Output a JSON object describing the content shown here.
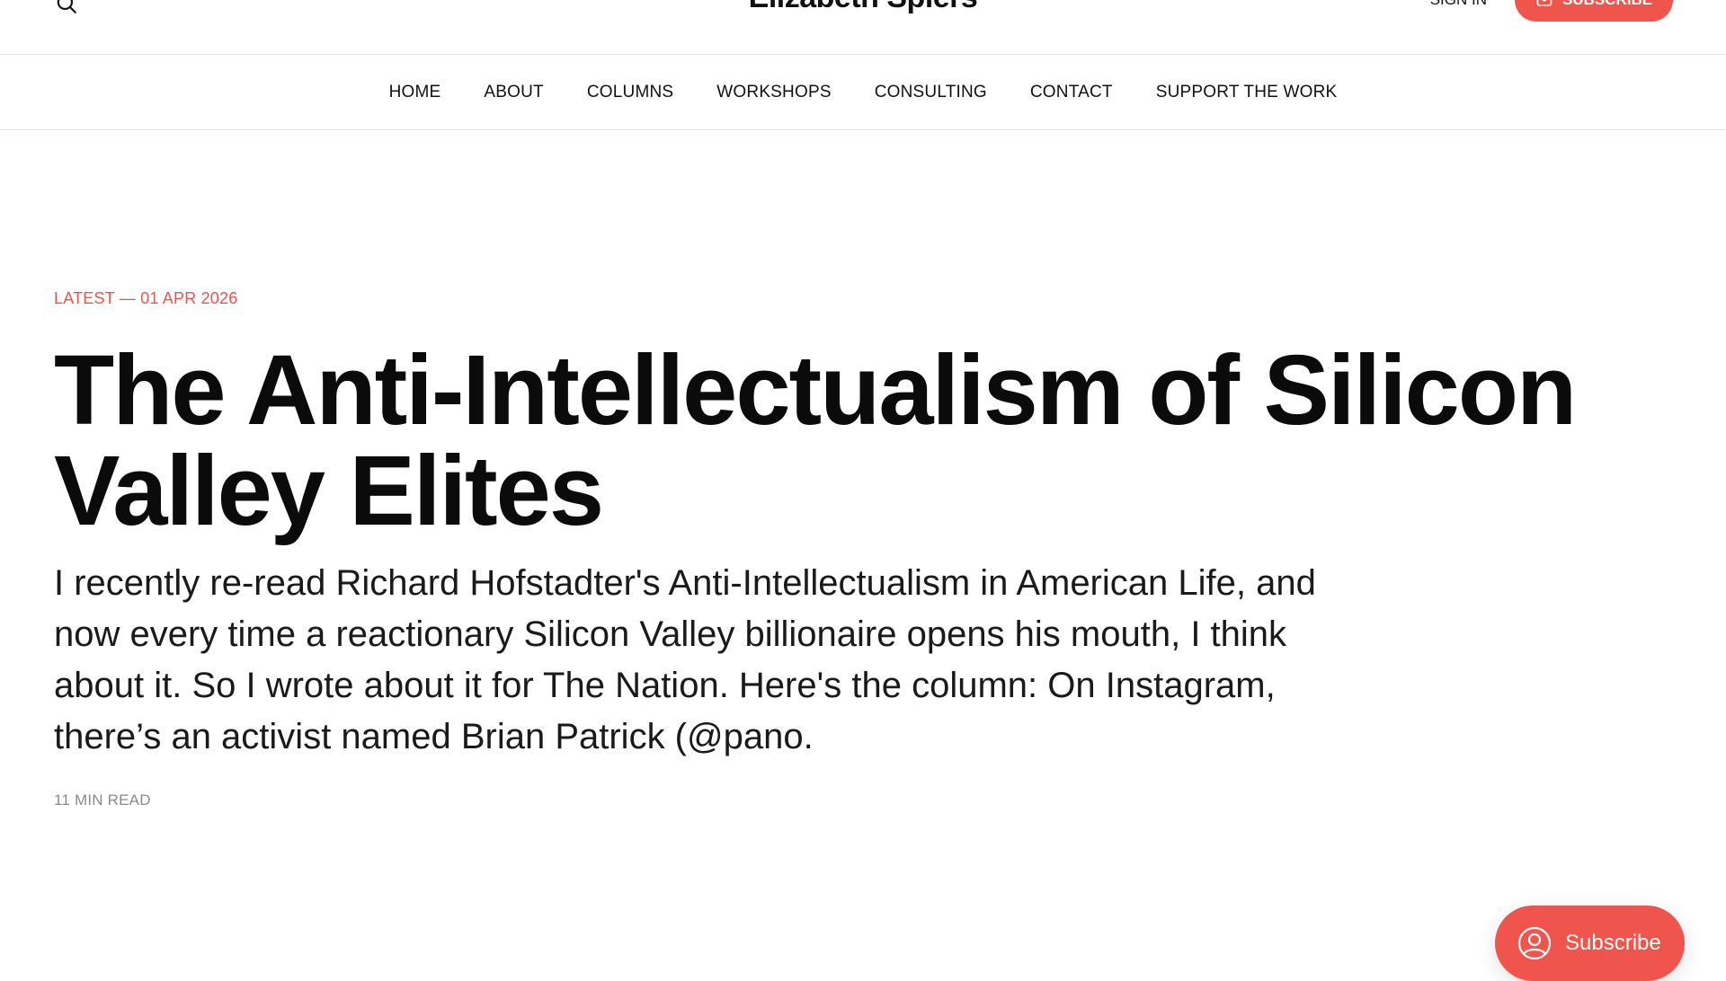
{
  "header": {
    "site_title": "Elizabeth Spiers",
    "search_icon": "search-icon",
    "sign_in_label": "SIGN IN",
    "subscribe_label": "SUBSCRIBE",
    "subscribe_icon": "mail-icon"
  },
  "nav": {
    "items": [
      {
        "label": "HOME"
      },
      {
        "label": "ABOUT"
      },
      {
        "label": "COLUMNS"
      },
      {
        "label": "WORKSHOPS"
      },
      {
        "label": "CONSULTING"
      },
      {
        "label": "CONTACT"
      },
      {
        "label": "SUPPORT THE WORK"
      }
    ]
  },
  "article": {
    "kicker": "LATEST — 01 APR 2026",
    "title": "The Anti-Intellectualism of Silicon Valley Elites",
    "excerpt": "I recently re-read Richard Hofstadter's Anti-Intellectualism in American Life, and now every time a reactionary Silicon Valley billionaire opens his mouth, I think about it. So I wrote about it for The Nation. Here's the column: On Instagram, there’s an activist named Brian Patrick (@pano.",
    "read_time": "11 MIN READ"
  },
  "portal": {
    "label": "Subscribe",
    "icon": "user-circle-icon"
  },
  "colors": {
    "accent": "#f0554d",
    "kicker": "#e8564b",
    "text": "#111111",
    "muted": "#8a8a8a",
    "border": "#e3e3e3"
  }
}
